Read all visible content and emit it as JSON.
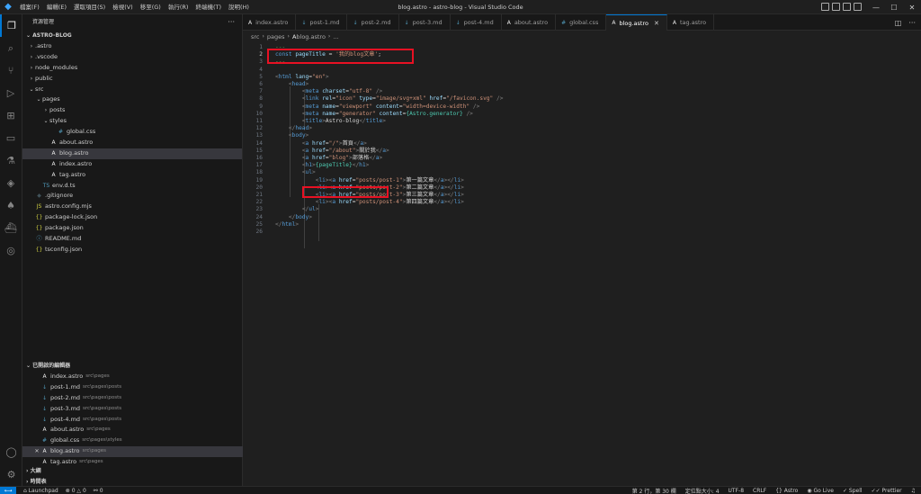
{
  "window": {
    "title": "blog.astro - astro-blog - Visual Studio Code",
    "menu": [
      "檔案(F)",
      "編輯(E)",
      "選取項目(S)",
      "檢視(V)",
      "移至(G)",
      "執行(R)",
      "終端機(T)",
      "說明(H)"
    ]
  },
  "sidebar": {
    "explorer_title": "資源管理",
    "project_title": "ASTRO-BLOG",
    "tree": [
      {
        "label": ".astro",
        "type": "folder",
        "depth": 0,
        "open": false
      },
      {
        "label": ".vscode",
        "type": "folder",
        "depth": 0,
        "open": false
      },
      {
        "label": "node_modules",
        "type": "folder",
        "depth": 0,
        "open": false
      },
      {
        "label": "public",
        "type": "folder",
        "depth": 0,
        "open": false
      },
      {
        "label": "src",
        "type": "folder",
        "depth": 0,
        "open": true
      },
      {
        "label": "pages",
        "type": "folder",
        "depth": 1,
        "open": true
      },
      {
        "label": "posts",
        "type": "folder",
        "depth": 2,
        "open": false
      },
      {
        "label": "styles",
        "type": "folder",
        "depth": 2,
        "open": true
      },
      {
        "label": "global.css",
        "type": "css",
        "depth": 3
      },
      {
        "label": "about.astro",
        "type": "astro",
        "depth": 2
      },
      {
        "label": "blog.astro",
        "type": "astro",
        "depth": 2,
        "selected": true
      },
      {
        "label": "index.astro",
        "type": "astro",
        "depth": 2
      },
      {
        "label": "tag.astro",
        "type": "astro",
        "depth": 2
      },
      {
        "label": "env.d.ts",
        "type": "ts",
        "depth": 1
      },
      {
        "label": ".gitignore",
        "type": "git",
        "depth": 0
      },
      {
        "label": "astro.config.mjs",
        "type": "js",
        "depth": 0
      },
      {
        "label": "package-lock.json",
        "type": "json",
        "depth": 0
      },
      {
        "label": "package.json",
        "type": "json",
        "depth": 0
      },
      {
        "label": "README.md",
        "type": "info",
        "depth": 0
      },
      {
        "label": "tsconfig.json",
        "type": "json",
        "depth": 0
      }
    ],
    "open_editors_title": "已開啟的編輯器",
    "open_editors": [
      {
        "label": "index.astro",
        "path": "src\\pages",
        "type": "astro"
      },
      {
        "label": "post-1.md",
        "path": "src\\pages\\posts",
        "type": "md"
      },
      {
        "label": "post-2.md",
        "path": "src\\pages\\posts",
        "type": "md"
      },
      {
        "label": "post-3.md",
        "path": "src\\pages\\posts",
        "type": "md"
      },
      {
        "label": "post-4.md",
        "path": "src\\pages\\posts",
        "type": "md"
      },
      {
        "label": "about.astro",
        "path": "src\\pages",
        "type": "astro"
      },
      {
        "label": "global.css",
        "path": "src\\pages\\styles",
        "type": "css"
      },
      {
        "label": "blog.astro",
        "path": "src\\pages",
        "type": "astro",
        "selected": true
      },
      {
        "label": "tag.astro",
        "path": "src\\pages",
        "type": "astro"
      }
    ],
    "outline_title": "大綱",
    "timeline_title": "時間表"
  },
  "tabs": [
    {
      "label": "index.astro",
      "type": "astro"
    },
    {
      "label": "post-1.md",
      "type": "md"
    },
    {
      "label": "post-2.md",
      "type": "md"
    },
    {
      "label": "post-3.md",
      "type": "md"
    },
    {
      "label": "post-4.md",
      "type": "md"
    },
    {
      "label": "about.astro",
      "type": "astro"
    },
    {
      "label": "global.css",
      "type": "css"
    },
    {
      "label": "blog.astro",
      "type": "astro",
      "active": true
    },
    {
      "label": "tag.astro",
      "type": "astro"
    }
  ],
  "breadcrumb": [
    "src",
    "pages",
    "blog.astro",
    "..."
  ],
  "code": [
    {
      "n": "1",
      "tokens": [
        [
          "dash",
          "---"
        ]
      ]
    },
    {
      "n": "2",
      "tokens": [
        [
          "kw",
          "const "
        ],
        [
          "var",
          "pageTitle"
        ],
        [
          "txt",
          " = "
        ],
        [
          "str",
          "'我的blog文章'"
        ],
        [
          "txt",
          ";"
        ]
      ]
    },
    {
      "n": "3",
      "tokens": [
        [
          "dash",
          "---"
        ]
      ]
    },
    {
      "n": "4",
      "tokens": []
    },
    {
      "n": "5",
      "tokens": [
        [
          "punc",
          "<"
        ],
        [
          "tag",
          "html"
        ],
        [
          "txt",
          " "
        ],
        [
          "attr",
          "lang"
        ],
        [
          "txt",
          "="
        ],
        [
          "str",
          "\"en\""
        ],
        [
          "punc",
          ">"
        ]
      ]
    },
    {
      "n": "6",
      "tokens": [
        [
          "txt",
          "    "
        ],
        [
          "punc",
          "<"
        ],
        [
          "tag",
          "head"
        ],
        [
          "punc",
          ">"
        ]
      ]
    },
    {
      "n": "7",
      "tokens": [
        [
          "txt",
          "        "
        ],
        [
          "punc",
          "<"
        ],
        [
          "tag",
          "meta"
        ],
        [
          "txt",
          " "
        ],
        [
          "attr",
          "charset"
        ],
        [
          "txt",
          "="
        ],
        [
          "str",
          "\"utf-8\""
        ],
        [
          "txt",
          " "
        ],
        [
          "punc",
          "/>"
        ]
      ]
    },
    {
      "n": "8",
      "tokens": [
        [
          "txt",
          "        "
        ],
        [
          "punc",
          "<"
        ],
        [
          "tag",
          "link"
        ],
        [
          "txt",
          " "
        ],
        [
          "attr",
          "rel"
        ],
        [
          "txt",
          "="
        ],
        [
          "str",
          "\"icon\""
        ],
        [
          "txt",
          " "
        ],
        [
          "attr",
          "type"
        ],
        [
          "txt",
          "="
        ],
        [
          "str",
          "\"image/svg+xml\""
        ],
        [
          "txt",
          " "
        ],
        [
          "attr",
          "href"
        ],
        [
          "txt",
          "="
        ],
        [
          "str",
          "\"/favicon.svg\""
        ],
        [
          "txt",
          " "
        ],
        [
          "punc",
          "/>"
        ]
      ]
    },
    {
      "n": "9",
      "tokens": [
        [
          "txt",
          "        "
        ],
        [
          "punc",
          "<"
        ],
        [
          "tag",
          "meta"
        ],
        [
          "txt",
          " "
        ],
        [
          "attr",
          "name"
        ],
        [
          "txt",
          "="
        ],
        [
          "str",
          "\"viewport\""
        ],
        [
          "txt",
          " "
        ],
        [
          "attr",
          "content"
        ],
        [
          "txt",
          "="
        ],
        [
          "str",
          "\"width=device-width\""
        ],
        [
          "txt",
          " "
        ],
        [
          "punc",
          "/>"
        ]
      ]
    },
    {
      "n": "10",
      "tokens": [
        [
          "txt",
          "        "
        ],
        [
          "punc",
          "<"
        ],
        [
          "tag",
          "meta"
        ],
        [
          "txt",
          " "
        ],
        [
          "attr",
          "name"
        ],
        [
          "txt",
          "="
        ],
        [
          "str",
          "\"generator\""
        ],
        [
          "txt",
          " "
        ],
        [
          "attr",
          "content"
        ],
        [
          "txt",
          "="
        ],
        [
          "expr",
          "{Astro.generator}"
        ],
        [
          "txt",
          " "
        ],
        [
          "punc",
          "/>"
        ]
      ]
    },
    {
      "n": "11",
      "tokens": [
        [
          "txt",
          "        "
        ],
        [
          "punc",
          "<"
        ],
        [
          "tag",
          "title"
        ],
        [
          "punc",
          ">"
        ],
        [
          "txt",
          "Astro-blog"
        ],
        [
          "punc",
          "</"
        ],
        [
          "tag",
          "title"
        ],
        [
          "punc",
          ">"
        ]
      ]
    },
    {
      "n": "12",
      "tokens": [
        [
          "txt",
          "    "
        ],
        [
          "punc",
          "</"
        ],
        [
          "tag",
          "head"
        ],
        [
          "punc",
          ">"
        ]
      ]
    },
    {
      "n": "13",
      "tokens": [
        [
          "txt",
          "    "
        ],
        [
          "punc",
          "<"
        ],
        [
          "tag",
          "body"
        ],
        [
          "punc",
          ">"
        ]
      ]
    },
    {
      "n": "14",
      "tokens": [
        [
          "txt",
          "        "
        ],
        [
          "punc",
          "<"
        ],
        [
          "tag",
          "a"
        ],
        [
          "txt",
          " "
        ],
        [
          "attr",
          "href"
        ],
        [
          "txt",
          "="
        ],
        [
          "str",
          "\"/\""
        ],
        [
          "punc",
          ">"
        ],
        [
          "txt",
          "首頁"
        ],
        [
          "punc",
          "</"
        ],
        [
          "tag",
          "a"
        ],
        [
          "punc",
          ">"
        ]
      ]
    },
    {
      "n": "15",
      "tokens": [
        [
          "txt",
          "        "
        ],
        [
          "punc",
          "<"
        ],
        [
          "tag",
          "a"
        ],
        [
          "txt",
          " "
        ],
        [
          "attr",
          "href"
        ],
        [
          "txt",
          "="
        ],
        [
          "str",
          "\"/about\""
        ],
        [
          "punc",
          ">"
        ],
        [
          "txt",
          "關於我"
        ],
        [
          "punc",
          "</"
        ],
        [
          "tag",
          "a"
        ],
        [
          "punc",
          ">"
        ]
      ]
    },
    {
      "n": "16",
      "tokens": [
        [
          "txt",
          "        "
        ],
        [
          "punc",
          "<"
        ],
        [
          "tag",
          "a"
        ],
        [
          "txt",
          " "
        ],
        [
          "attr",
          "href"
        ],
        [
          "txt",
          "="
        ],
        [
          "str",
          "\"blog\""
        ],
        [
          "punc",
          ">"
        ],
        [
          "txt",
          "部落格"
        ],
        [
          "punc",
          "</"
        ],
        [
          "tag",
          "a"
        ],
        [
          "punc",
          ">"
        ]
      ]
    },
    {
      "n": "17",
      "tokens": [
        [
          "txt",
          "        "
        ],
        [
          "punc",
          "<"
        ],
        [
          "tag",
          "h1"
        ],
        [
          "punc",
          ">"
        ],
        [
          "expr",
          "{pageTitle}"
        ],
        [
          "punc",
          "</"
        ],
        [
          "tag",
          "h1"
        ],
        [
          "punc",
          ">"
        ]
      ]
    },
    {
      "n": "18",
      "tokens": [
        [
          "txt",
          "        "
        ],
        [
          "punc",
          "<"
        ],
        [
          "tag",
          "ul"
        ],
        [
          "punc",
          ">"
        ]
      ]
    },
    {
      "n": "19",
      "tokens": [
        [
          "txt",
          "            "
        ],
        [
          "punc",
          "<"
        ],
        [
          "tag",
          "li"
        ],
        [
          "punc",
          "><"
        ],
        [
          "tag",
          "a"
        ],
        [
          "txt",
          " "
        ],
        [
          "attr",
          "href"
        ],
        [
          "txt",
          "="
        ],
        [
          "str",
          "\"posts/post-1\""
        ],
        [
          "punc",
          ">"
        ],
        [
          "txt",
          "第一篇文章"
        ],
        [
          "punc",
          "</"
        ],
        [
          "tag",
          "a"
        ],
        [
          "punc",
          "></"
        ],
        [
          "tag",
          "li"
        ],
        [
          "punc",
          ">"
        ]
      ]
    },
    {
      "n": "20",
      "tokens": [
        [
          "txt",
          "            "
        ],
        [
          "punc",
          "<"
        ],
        [
          "tag",
          "li"
        ],
        [
          "punc",
          "><"
        ],
        [
          "tag",
          "a"
        ],
        [
          "txt",
          " "
        ],
        [
          "attr",
          "href"
        ],
        [
          "txt",
          "="
        ],
        [
          "str",
          "\"posts/post-2\""
        ],
        [
          "punc",
          ">"
        ],
        [
          "txt",
          "第二篇文章"
        ],
        [
          "punc",
          "</"
        ],
        [
          "tag",
          "a"
        ],
        [
          "punc",
          "></"
        ],
        [
          "tag",
          "li"
        ],
        [
          "punc",
          ">"
        ]
      ]
    },
    {
      "n": "21",
      "tokens": [
        [
          "txt",
          "            "
        ],
        [
          "punc",
          "<"
        ],
        [
          "tag",
          "li"
        ],
        [
          "punc",
          "><"
        ],
        [
          "tag",
          "a"
        ],
        [
          "txt",
          " "
        ],
        [
          "attr",
          "href"
        ],
        [
          "txt",
          "="
        ],
        [
          "str",
          "\"posts/post-3\""
        ],
        [
          "punc",
          ">"
        ],
        [
          "txt",
          "第三篇文章"
        ],
        [
          "punc",
          "</"
        ],
        [
          "tag",
          "a"
        ],
        [
          "punc",
          "></"
        ],
        [
          "tag",
          "li"
        ],
        [
          "punc",
          ">"
        ]
      ]
    },
    {
      "n": "22",
      "tokens": [
        [
          "txt",
          "            "
        ],
        [
          "punc",
          "<"
        ],
        [
          "tag",
          "li"
        ],
        [
          "punc",
          "><"
        ],
        [
          "tag",
          "a"
        ],
        [
          "txt",
          " "
        ],
        [
          "attr",
          "href"
        ],
        [
          "txt",
          "="
        ],
        [
          "str",
          "\"posts/post-4\""
        ],
        [
          "punc",
          ">"
        ],
        [
          "txt",
          "第四篇文章"
        ],
        [
          "punc",
          "</"
        ],
        [
          "tag",
          "a"
        ],
        [
          "punc",
          "></"
        ],
        [
          "tag",
          "li"
        ],
        [
          "punc",
          ">"
        ]
      ]
    },
    {
      "n": "23",
      "tokens": [
        [
          "txt",
          "        "
        ],
        [
          "punc",
          "</"
        ],
        [
          "tag",
          "ul"
        ],
        [
          "punc",
          ">"
        ]
      ]
    },
    {
      "n": "24",
      "tokens": [
        [
          "txt",
          "    "
        ],
        [
          "punc",
          "</"
        ],
        [
          "tag",
          "body"
        ],
        [
          "punc",
          ">"
        ]
      ]
    },
    {
      "n": "25",
      "tokens": [
        [
          "punc",
          "</"
        ],
        [
          "tag",
          "html"
        ],
        [
          "punc",
          ">"
        ]
      ]
    },
    {
      "n": "26",
      "tokens": []
    }
  ],
  "statusbar": {
    "launchpad": "Launchpad",
    "errors": "0",
    "warnings": "0",
    "ports": "0",
    "position": "第 2 行，第 30 欄",
    "indent": "定位點大小: 4",
    "encoding": "UTF-8",
    "eol": "CRLF",
    "language": "Astro",
    "golive": "Go Live",
    "spell": "Spell",
    "prettier": "Prettier"
  },
  "colors": {
    "accent": "#0078d4",
    "highlight_box": "#e81123"
  }
}
